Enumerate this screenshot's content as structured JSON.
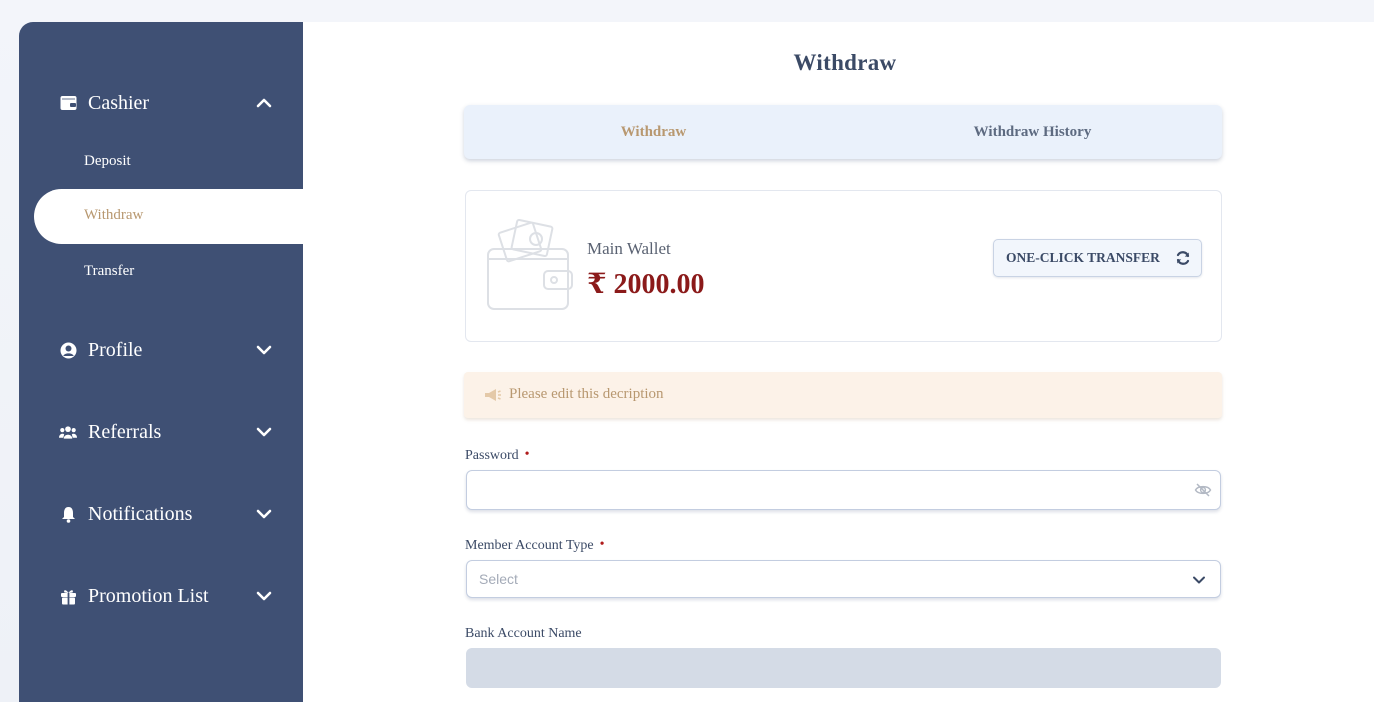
{
  "sidebar": {
    "cashier": {
      "label": "Cashier",
      "icon": "wallet-icon",
      "expanded": true
    },
    "submenu": [
      {
        "label": "Deposit",
        "active": false
      },
      {
        "label": "Withdraw",
        "active": true
      },
      {
        "label": "Transfer",
        "active": false
      }
    ],
    "items": [
      {
        "label": "Profile",
        "icon": "user-circle-icon"
      },
      {
        "label": "Referrals",
        "icon": "users-icon"
      },
      {
        "label": "Notifications",
        "icon": "bell-icon"
      },
      {
        "label": "Promotion List",
        "icon": "gift-icon"
      }
    ]
  },
  "main": {
    "title": "Withdraw",
    "tabs": [
      {
        "label": "Withdraw",
        "active": true
      },
      {
        "label": "Withdraw History",
        "active": false
      }
    ],
    "wallet": {
      "label": "Main Wallet",
      "amount": "₹ 2000.00",
      "transfer_button": "ONE-CLICK TRANSFER"
    },
    "notice": "Please edit this decription",
    "form": {
      "password_label": "Password",
      "password_required": "•",
      "password_value": "",
      "account_type_label": "Member Account Type",
      "account_type_required": "•",
      "account_type_placeholder": "Select",
      "bank_account_name_label": "Bank Account Name"
    }
  },
  "colors": {
    "sidebar_bg": "#3f5074",
    "accent": "#b89870",
    "amount": "#8b1a1a",
    "required": "#b01b1b"
  }
}
